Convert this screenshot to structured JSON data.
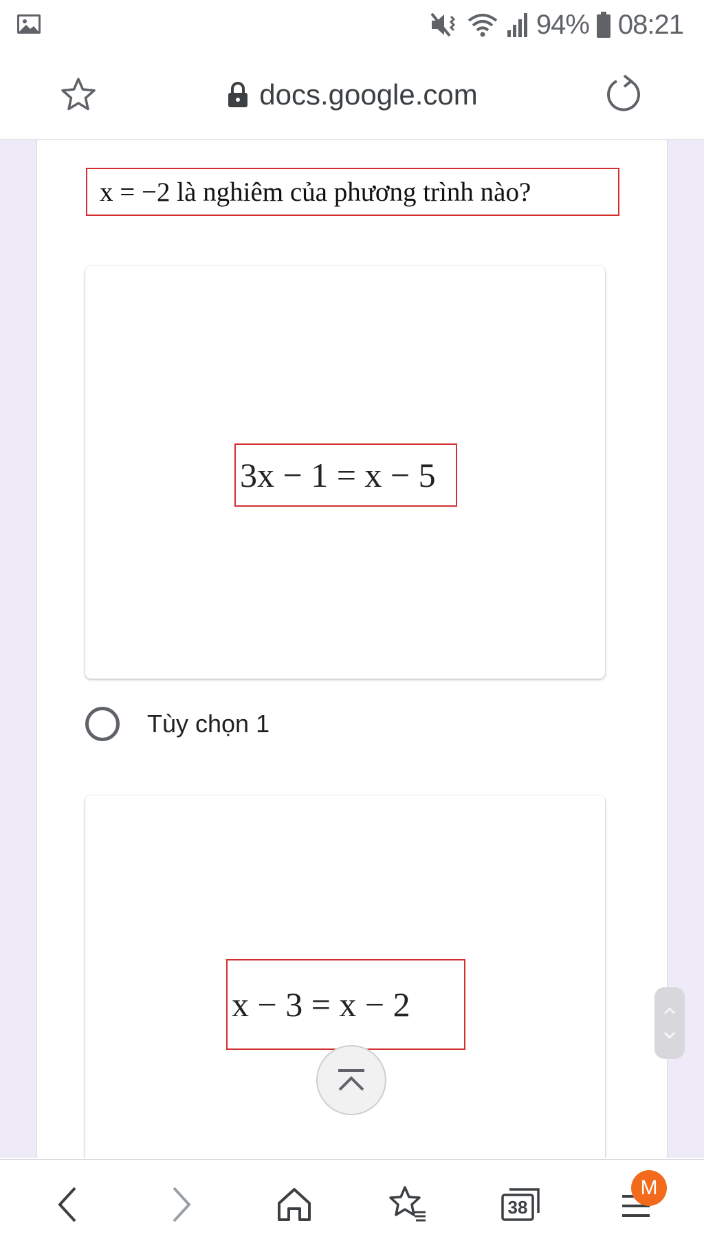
{
  "status_bar": {
    "battery_percent": "94%",
    "time": "08:21",
    "icons": [
      "gallery-notification-icon",
      "mute-vibrate-icon",
      "wifi-icon",
      "signal-icon",
      "battery-icon"
    ]
  },
  "address_bar": {
    "url": "docs.google.com",
    "icons": [
      "star-icon",
      "lock-icon",
      "reload-icon"
    ]
  },
  "form": {
    "question": "x = −2  là nghiêm của phương trình nào?",
    "options": [
      {
        "equation": "3x − 1 = x − 5",
        "label": "Tùy chọn 1"
      },
      {
        "equation": "x − 3 = x − 2"
      }
    ]
  },
  "bottom_nav": {
    "tabs_count": "38",
    "menu_badge": "M",
    "icons": [
      "back-icon",
      "forward-icon",
      "home-icon",
      "bookmarks-icon",
      "tabs-icon",
      "menu-icon"
    ]
  },
  "colors": {
    "page_background": "#eeeaf7",
    "equation_border": "#d32f2f",
    "badge": "#f26b1d"
  }
}
